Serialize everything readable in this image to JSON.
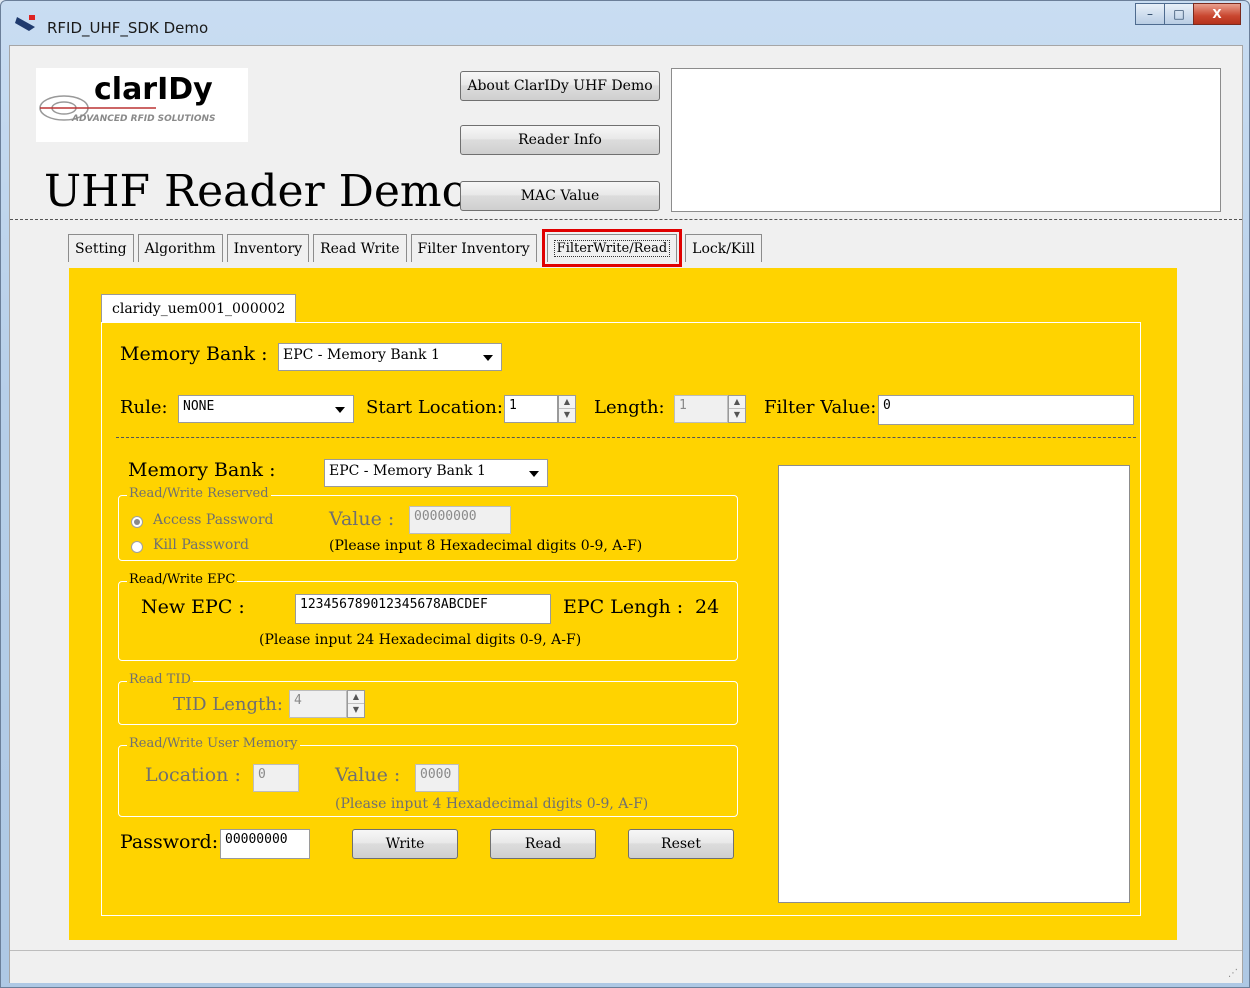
{
  "window": {
    "title": "RFID_UHF_SDK Demo",
    "controls": {
      "minimize": "–",
      "maximize": "□",
      "close": "X"
    }
  },
  "header": {
    "logo": {
      "brand": "clarIDy",
      "tagline": "ADVANCED RFID SOLUTIONS"
    },
    "app_title": "UHF Reader Demo",
    "buttons": {
      "about": "About ClarIDy UHF Demo",
      "reader_info": "Reader Info",
      "mac_value": "MAC Value"
    }
  },
  "tabs": [
    "Setting",
    "Algorithm",
    "Inventory",
    "Read Write",
    "Filter Inventory",
    "FilterWrite/Read",
    "Lock/Kill"
  ],
  "active_tab": "FilterWrite/Read",
  "reader_tab": "claridy_uem001_000002",
  "filter": {
    "memory_bank_label": "Memory Bank :",
    "memory_bank_value": "EPC - Memory Bank 1",
    "rule_label": "Rule:",
    "rule_value": "NONE",
    "start_label": "Start Location:",
    "start_value": "1",
    "length_label": "Length:",
    "length_value": "1",
    "filter_value_label": "Filter Value:",
    "filter_value": "0"
  },
  "access": {
    "memory_bank_label": "Memory Bank :",
    "memory_bank_value": "EPC - Memory Bank 1",
    "reserved": {
      "title": "Read/Write Reserved",
      "access_password": "Access Password",
      "kill_password": "Kill Password",
      "value_label": "Value :",
      "value": "00000000",
      "hint": "(Please input 8 Hexadecimal digits 0-9, A-F)"
    },
    "epc": {
      "title": "Read/Write EPC",
      "new_epc_label": "New EPC :",
      "new_epc_value": "123456789012345678ABCDEF",
      "length_label": "EPC Lengh :",
      "length_value": "24",
      "hint": "(Please input 24 Hexadecimal digits 0-9, A-F)"
    },
    "tid": {
      "title": "Read TID",
      "length_label": "TID Length:",
      "length_value": "4"
    },
    "user": {
      "title": "Read/Write User Memory",
      "location_label": "Location :",
      "location_value": "0",
      "value_label": "Value :",
      "value": "0000",
      "hint": "(Please input 4 Hexadecimal digits 0-9, A-F)"
    },
    "password_label": "Password:",
    "password_value": "00000000",
    "buttons": {
      "write": "Write",
      "read": "Read",
      "reset": "Reset"
    }
  },
  "colors": {
    "panel": "#ffd300",
    "highlight": "#e00000"
  }
}
